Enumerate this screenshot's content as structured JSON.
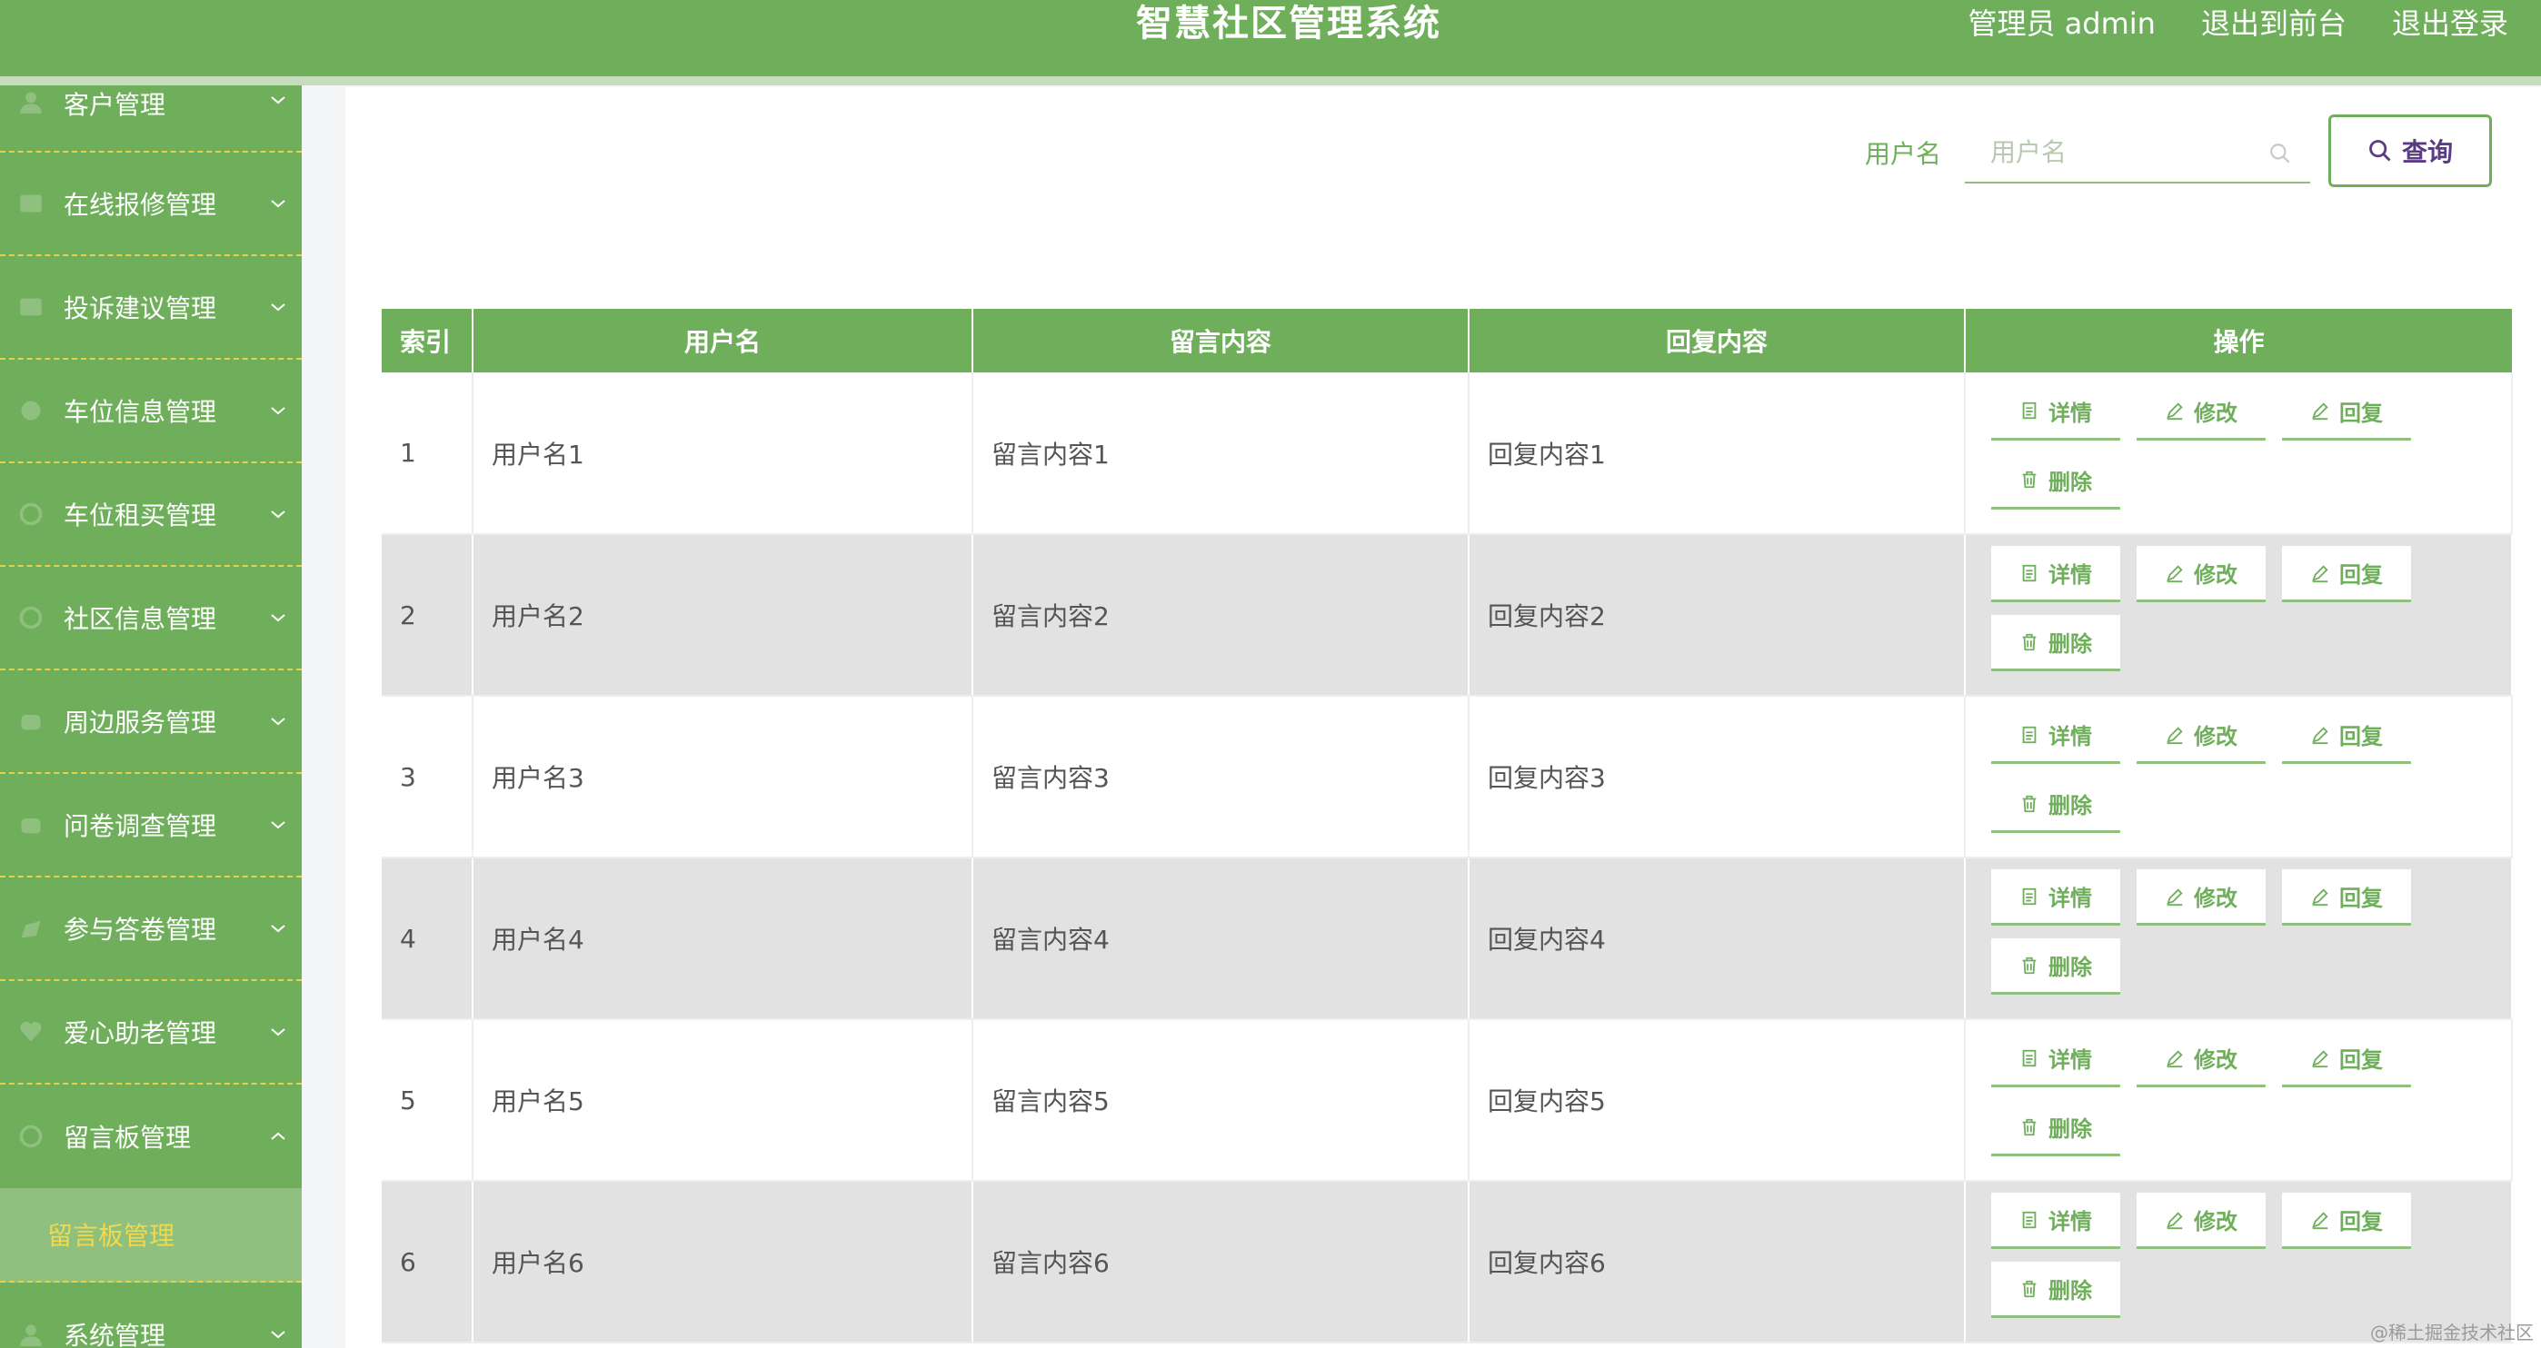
{
  "header": {
    "title": "智慧社区管理系统",
    "user_label": "管理员 admin",
    "to_front_label": "退出到前台",
    "logout_label": "退出登录"
  },
  "sidebar": {
    "items": [
      {
        "label": "客户管理",
        "icon": "user-icon"
      },
      {
        "label": "在线报修管理",
        "icon": "wrench-icon"
      },
      {
        "label": "投诉建议管理",
        "icon": "message-icon"
      },
      {
        "label": "车位信息管理",
        "icon": "car-icon"
      },
      {
        "label": "车位租买管理",
        "icon": "key-icon"
      },
      {
        "label": "社区信息管理",
        "icon": "building-icon"
      },
      {
        "label": "周边服务管理",
        "icon": "shop-icon"
      },
      {
        "label": "问卷调查管理",
        "icon": "clipboard-icon"
      },
      {
        "label": "参与答卷管理",
        "icon": "edit-icon"
      },
      {
        "label": "爱心助老管理",
        "icon": "heart-icon"
      },
      {
        "label": "留言板管理",
        "icon": "board-icon",
        "expanded": true
      }
    ],
    "sub_item": "留言板管理",
    "last_item": {
      "label": "系统管理",
      "icon": "settings-icon"
    }
  },
  "search": {
    "label": "用户名",
    "placeholder": "用户名",
    "button_label": "查询"
  },
  "table": {
    "columns": [
      "索引",
      "用户名",
      "留言内容",
      "回复内容",
      "操作"
    ],
    "rows": [
      {
        "index": "1",
        "username": "用户名1",
        "message": "留言内容1",
        "reply": "回复内容1"
      },
      {
        "index": "2",
        "username": "用户名2",
        "message": "留言内容2",
        "reply": "回复内容2"
      },
      {
        "index": "3",
        "username": "用户名3",
        "message": "留言内容3",
        "reply": "回复内容3"
      },
      {
        "index": "4",
        "username": "用户名4",
        "message": "留言内容4",
        "reply": "回复内容4"
      },
      {
        "index": "5",
        "username": "用户名5",
        "message": "留言内容5",
        "reply": "回复内容5"
      },
      {
        "index": "6",
        "username": "用户名6",
        "message": "留言内容6",
        "reply": "回复内容6"
      }
    ],
    "actions": {
      "detail": "详情",
      "edit": "修改",
      "reply": "回复",
      "delete": "删除"
    }
  },
  "watermark": "@稀土掘金技术社区",
  "colors": {
    "primary": "#6faf5c",
    "accent": "#f1d94d",
    "stripe": "#e2e2e2"
  }
}
